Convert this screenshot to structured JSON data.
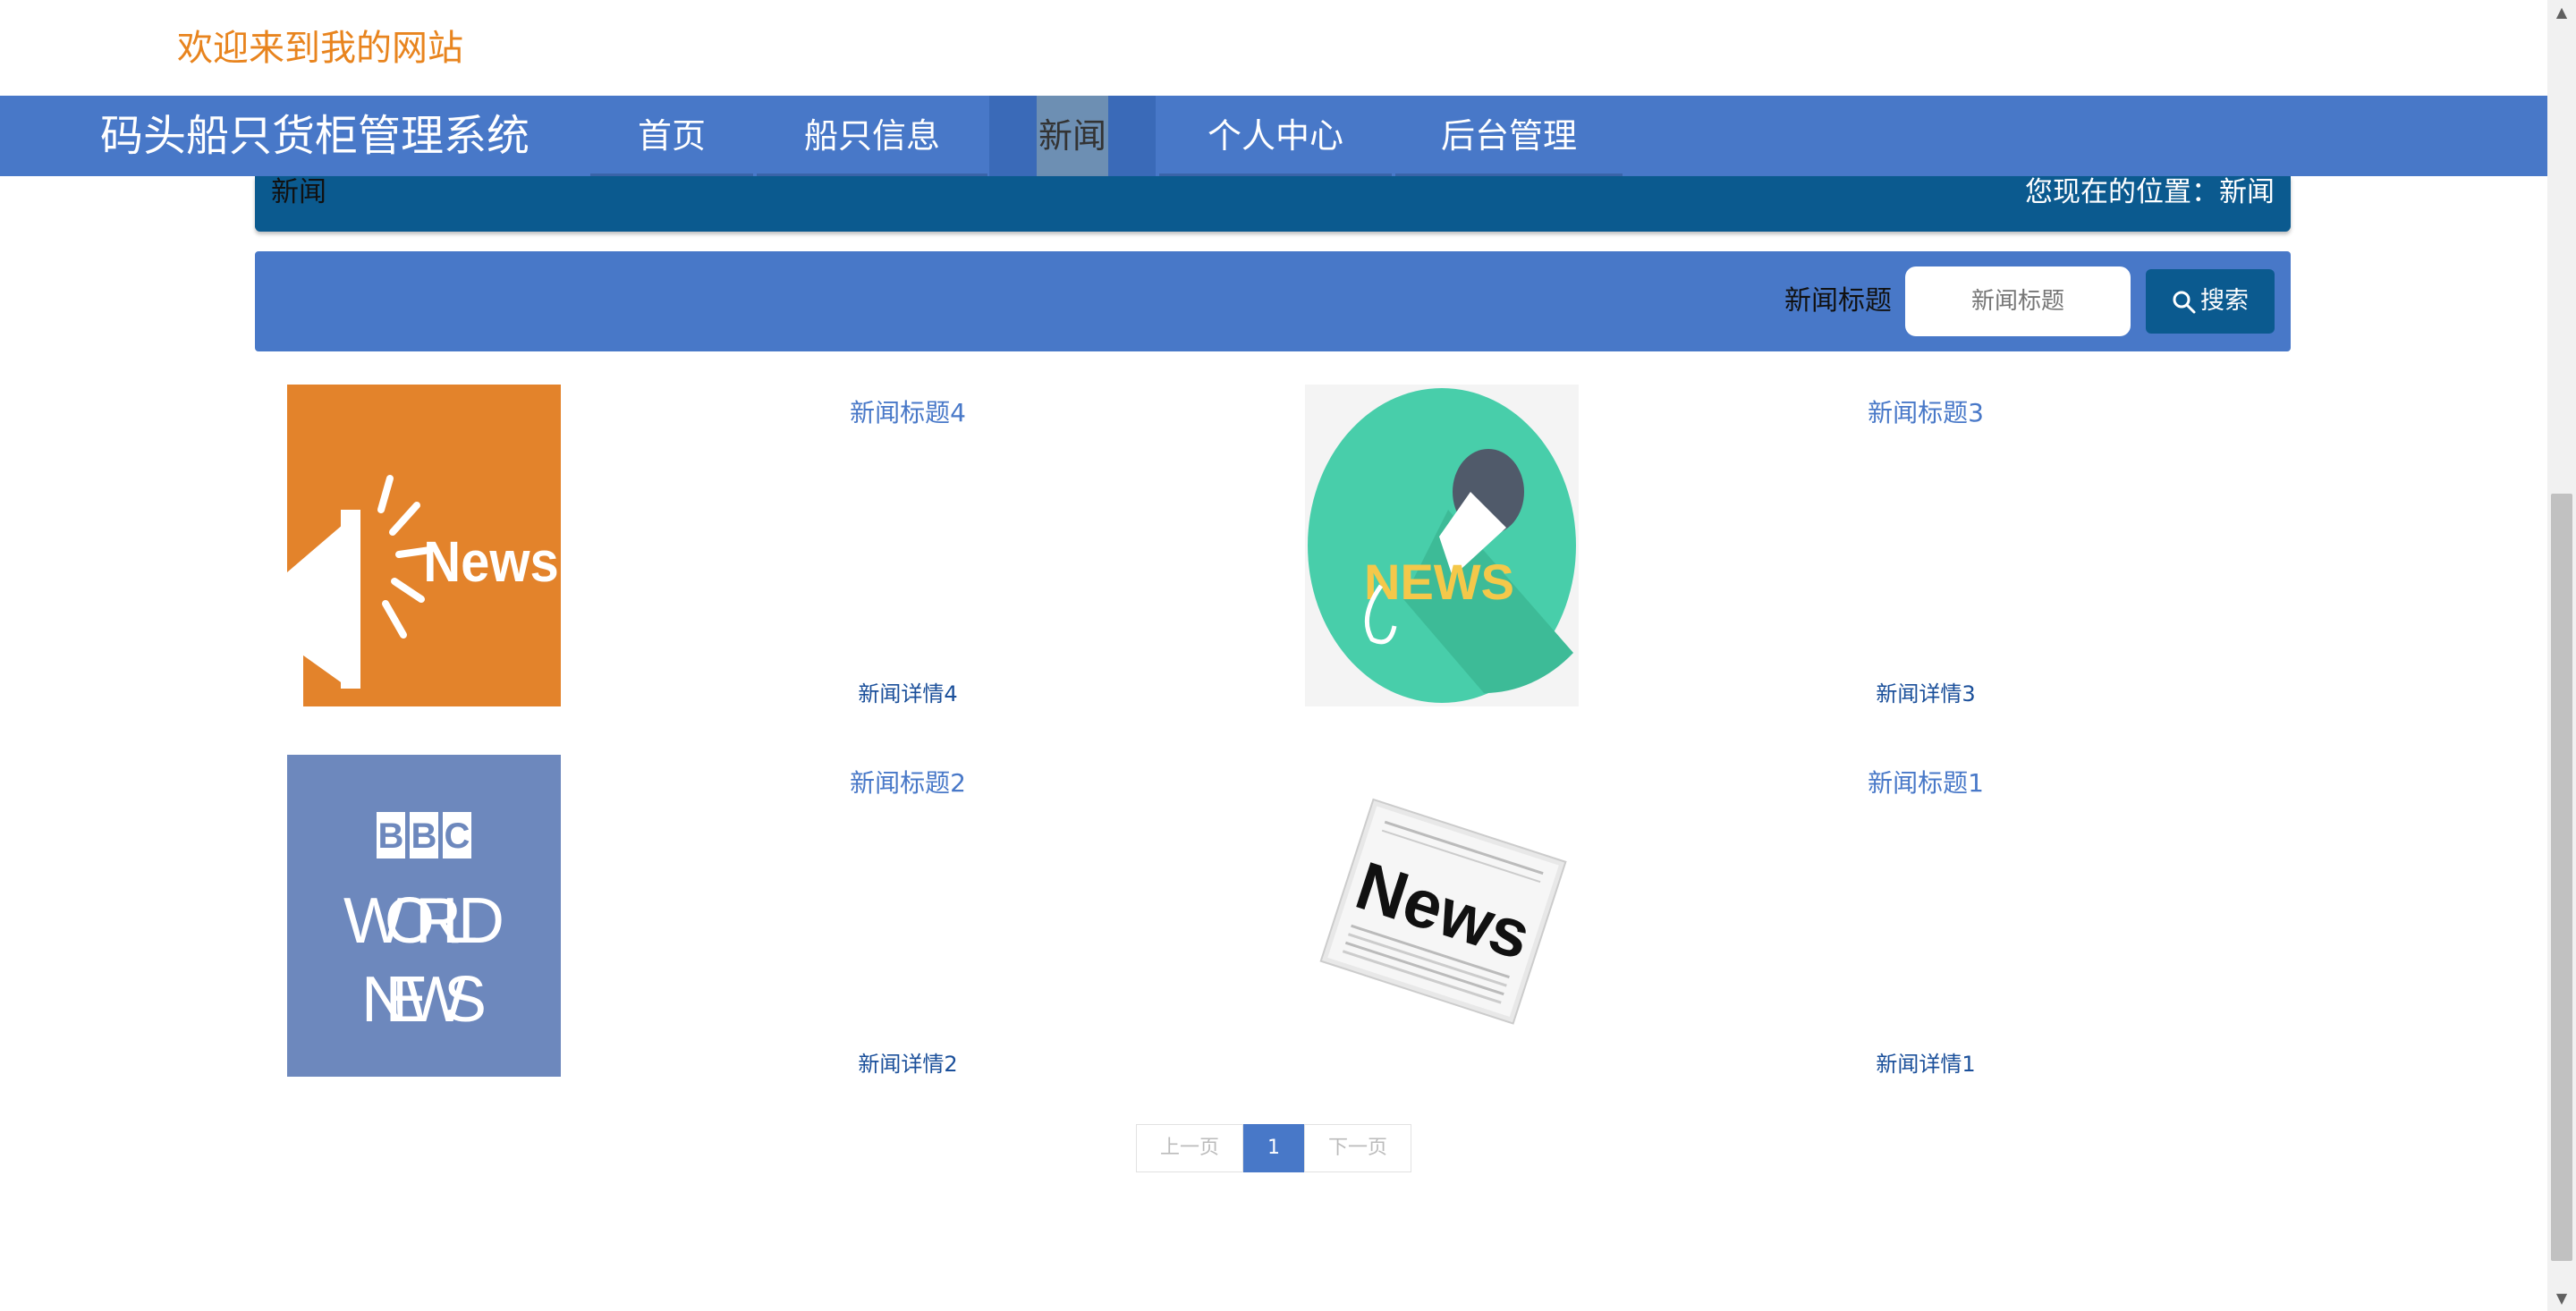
{
  "welcome": "欢迎来到我的网站",
  "nav": {
    "brand": "码头船只货柜管理系统",
    "items": [
      {
        "label": "首页"
      },
      {
        "label": "船只信息"
      },
      {
        "label": "新闻"
      },
      {
        "label": "个人中心"
      },
      {
        "label": "后台管理"
      }
    ],
    "active": "新闻"
  },
  "breadcrumb": {
    "section": "新闻",
    "location": "您现在的位置：新闻"
  },
  "search": {
    "label": "新闻标题",
    "placeholder": "新闻标题",
    "button": "搜索"
  },
  "news": [
    {
      "title": "新闻标题4",
      "detail": "新闻详情4",
      "image": "news-megaphone"
    },
    {
      "title": "新闻标题3",
      "detail": "新闻详情3",
      "image": "news-microphone"
    },
    {
      "title": "新闻标题2",
      "detail": "新闻详情2",
      "image": "bbc-world-news",
      "image_text": [
        "BBC",
        "WORLD",
        "NEWS"
      ]
    },
    {
      "title": "新闻标题1",
      "detail": "新闻详情1",
      "image": "newspaper"
    }
  ],
  "image_text": {
    "news": "News",
    "news_caps": "NEWS"
  },
  "pagination": {
    "prev": "上一页",
    "current": "1",
    "next": "下一页"
  },
  "colors": {
    "accent": "#4878c8",
    "dark": "#0b5a8f",
    "welcome": "#e8841e"
  }
}
